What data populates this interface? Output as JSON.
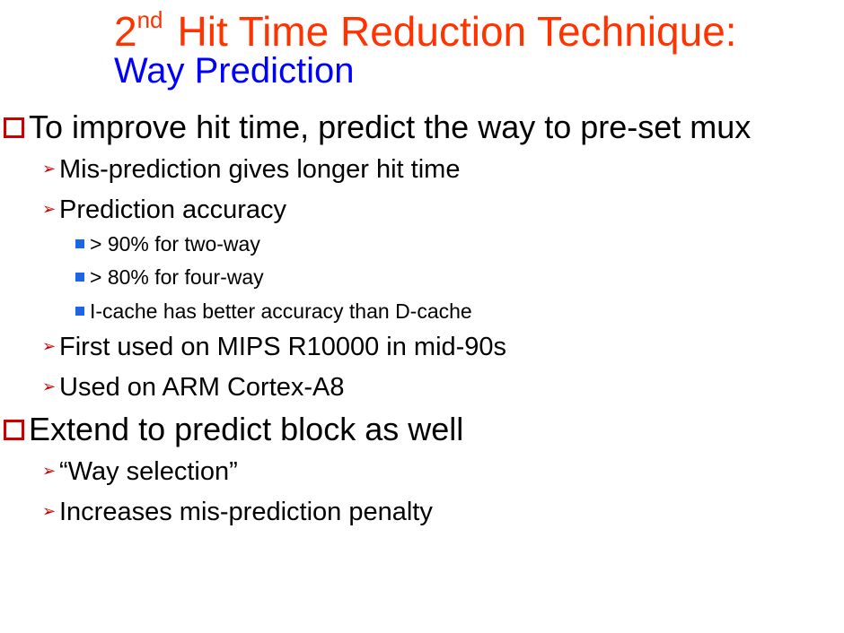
{
  "title": {
    "ordinal_number": "2",
    "ordinal_suffix": "nd",
    "main": "Hit Time Reduction Technique:",
    "subtitle": "Way Prediction"
  },
  "bullets": [
    {
      "text": "To improve hit time, predict the way to pre-set mux",
      "children": [
        {
          "text": "Mis-prediction gives longer hit time"
        },
        {
          "text": "Prediction accuracy",
          "children": [
            {
              "text": "> 90% for two-way"
            },
            {
              "text": "> 80% for four-way"
            },
            {
              "text": "I-cache has better accuracy than D-cache"
            }
          ]
        },
        {
          "text": "First used on MIPS R10000 in mid-90s"
        },
        {
          "text": "Used on ARM Cortex-A8"
        }
      ]
    },
    {
      "text": "Extend to predict block as well",
      "children": [
        {
          "text": "“Way selection”"
        },
        {
          "text": "Increases mis-prediction penalty"
        }
      ]
    }
  ],
  "colors": {
    "title": "#ff3300",
    "subtitle": "#0000ff",
    "level1_bullet": "#cc0000",
    "level2_bullet": "#cc0000",
    "level3_bullet": "#1a66e6"
  },
  "icons": {
    "level1": "hollow-square-bullet",
    "level2": "arrowhead-bullet",
    "level3": "filled-square-bullet"
  }
}
